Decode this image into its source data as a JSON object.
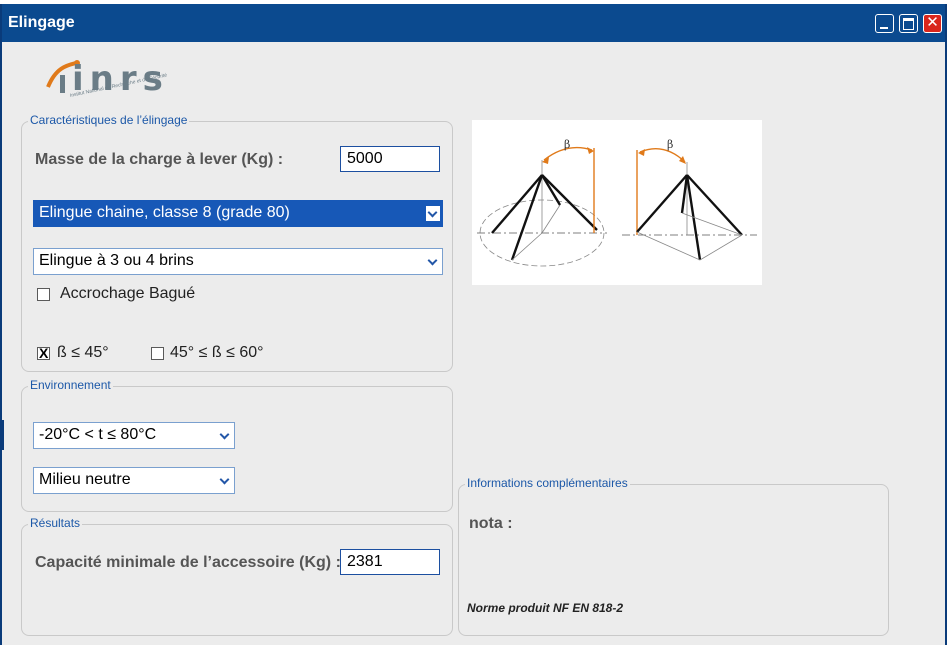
{
  "window": {
    "title": "Elingage"
  },
  "logo": {
    "text": "inrs",
    "subtitle": "Institut National de Recherche et de Sécurité"
  },
  "caracteristiques": {
    "legend": "Caractéristiques de l’élingage",
    "masse_label": "Masse de la charge à lever (Kg) :",
    "masse_value": "5000",
    "type_elingue": "Elingue chaine, classe 8 (grade 80)",
    "nb_brins": "Elingue à 3 ou 4 brins",
    "accrochage_label": "Accrochage Bagué",
    "accrochage_checked": false,
    "angle1_label": "ß ≤ 45°",
    "angle1_checked": true,
    "angle2_label": "45° ≤ ß ≤ 60°",
    "angle2_checked": false
  },
  "diagram": {
    "beta_left": "β",
    "beta_right": "β"
  },
  "environnement": {
    "legend": "Environnement",
    "temperature": "-20°C < t ≤ 80°C",
    "milieu": "Milieu neutre"
  },
  "resultats": {
    "legend": "Résultats",
    "capacite_label": "Capacité minimale de l’accessoire (Kg) :",
    "capacite_value": "2381"
  },
  "informations": {
    "legend": "Informations complémentaires",
    "nota_label": "nota :",
    "norme": "Norme produit NF EN 818-2"
  },
  "colors": {
    "titlebar": "#0b4a8f",
    "accent": "#1c58a8",
    "highlight": "#1758b7",
    "close": "#d9261c",
    "orange": "#e07a1a"
  }
}
